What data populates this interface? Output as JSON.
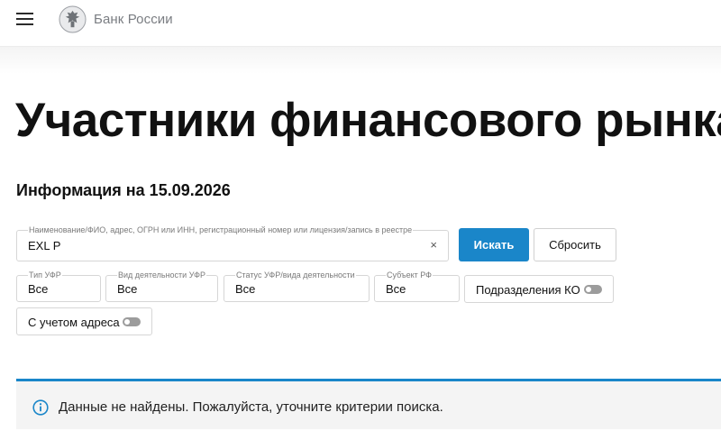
{
  "header": {
    "menu_icon": "hamburger-menu-icon",
    "logo_icon": "bank-of-russia-emblem-icon",
    "brand": "Банк России"
  },
  "page": {
    "title": "Участники финансового рынка",
    "info_date": "Информация на 15.09.2026"
  },
  "search": {
    "label": "Наименование/ФИО, адрес, ОГРН или ИНН, регистрационный номер или лицензия/запись в реестре",
    "value": "EXL P",
    "clear_symbol": "×",
    "search_button": "Искать",
    "reset_button": "Сбросить"
  },
  "filters": {
    "type": {
      "label": "Тип УФР",
      "value": "Все"
    },
    "activity": {
      "label": "Вид деятельности УФР",
      "value": "Все"
    },
    "status": {
      "label": "Статус УФР/вида деятельности",
      "value": "Все"
    },
    "region": {
      "label": "Субъект РФ",
      "value": "Все"
    },
    "ko_divisions": {
      "label": "Подразделения КО",
      "enabled": false
    },
    "with_address": {
      "label": "С учетом адреса",
      "enabled": false
    }
  },
  "alert": {
    "icon": "info-icon",
    "text": "Данные не найдены. Пожалуйста, уточните критерии поиска.",
    "accent_color": "#1a86c9"
  },
  "colors": {
    "primary": "#1a86c9",
    "alert_bg": "#f4f4f4"
  }
}
